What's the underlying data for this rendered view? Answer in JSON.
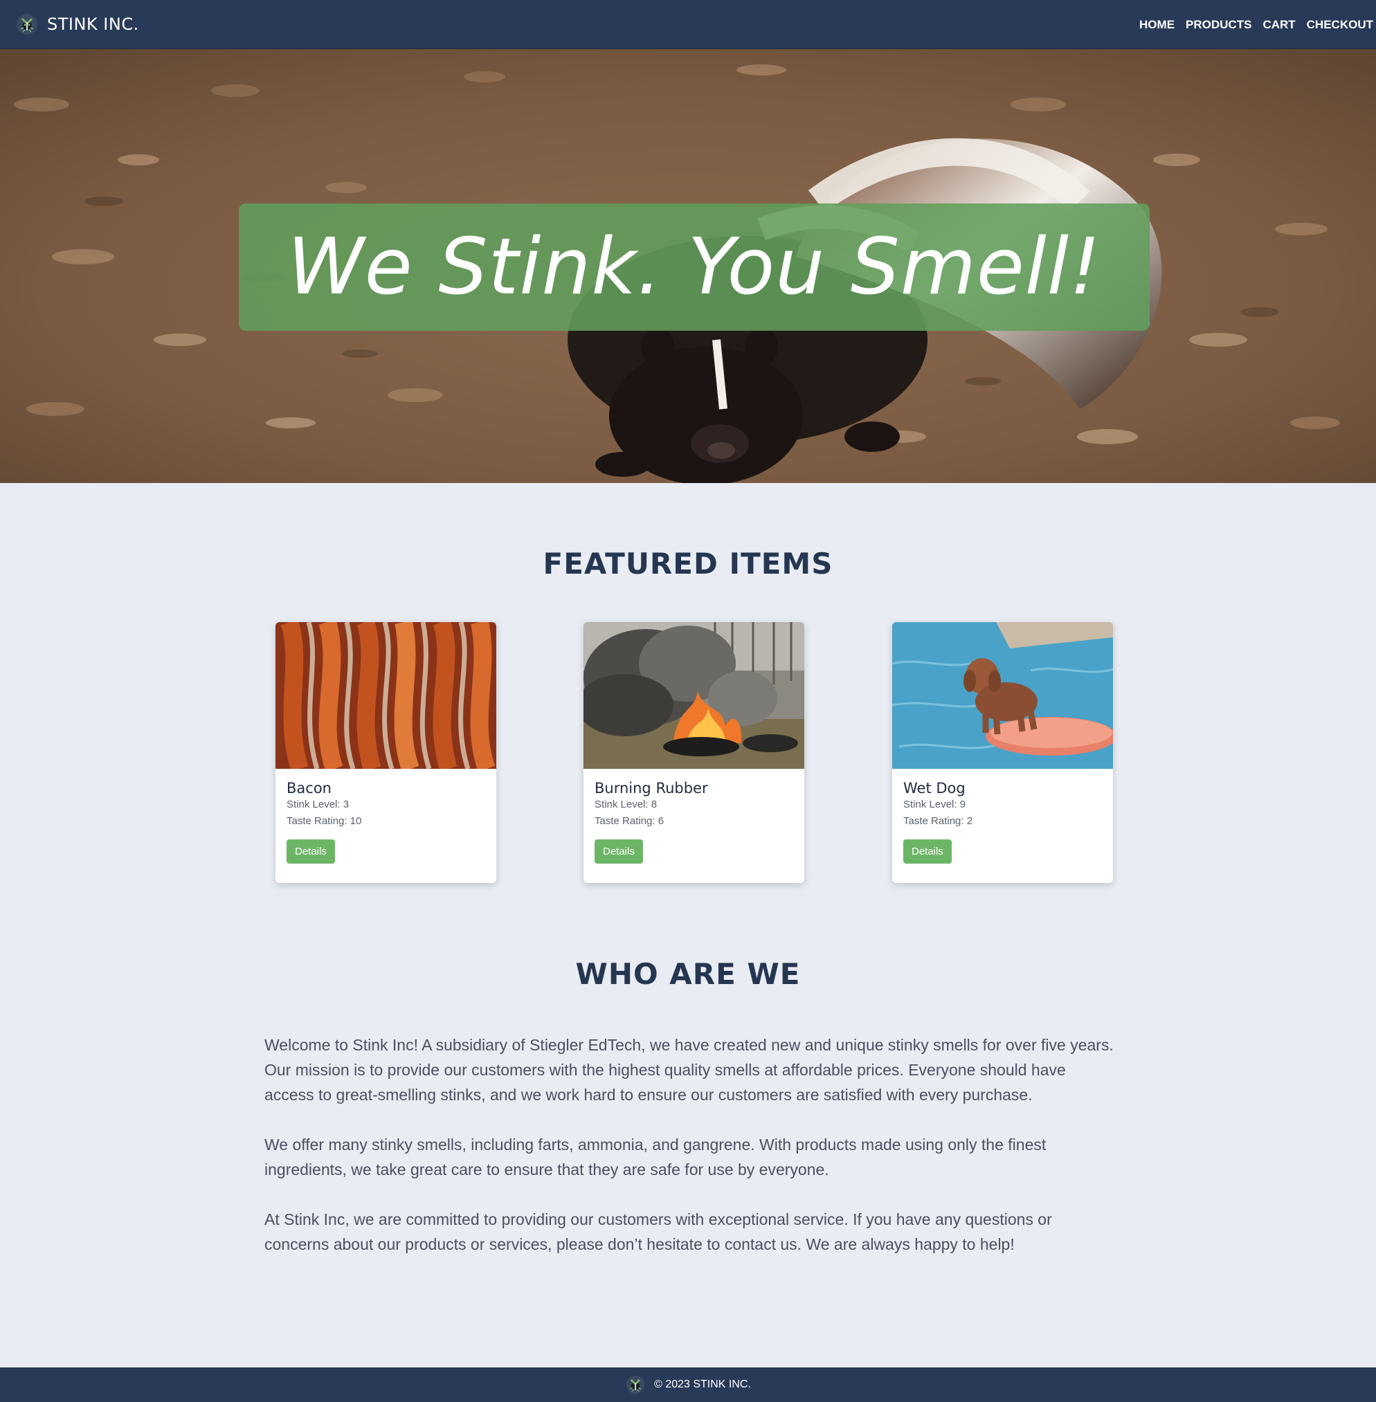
{
  "brand": {
    "name": "STINK INC.",
    "logo_icon": "skunk-logo-icon"
  },
  "nav": {
    "links": [
      "HOME",
      "PRODUCTS",
      "CART",
      "CHECKOUT"
    ]
  },
  "hero": {
    "headline": "We Stink. You Smell!",
    "background_image": "skunk-photo",
    "banner_color": "#629e5c"
  },
  "featured": {
    "title": "FEATURED ITEMS",
    "items": [
      {
        "name": "Bacon",
        "stink_level": "Stink Level: 3",
        "taste_rating": "Taste Rating: 10",
        "button": "Details",
        "image": "bacon-photo"
      },
      {
        "name": "Burning Rubber",
        "stink_level": "Stink Level: 8",
        "taste_rating": "Taste Rating: 6",
        "button": "Details",
        "image": "burning-tire-photo"
      },
      {
        "name": "Wet Dog",
        "stink_level": "Stink Level: 9",
        "taste_rating": "Taste Rating: 2",
        "button": "Details",
        "image": "wet-dog-photo"
      }
    ]
  },
  "about": {
    "title": "WHO ARE WE",
    "paragraphs": [
      "Welcome to Stink Inc! A subsidiary of Stiegler EdTech, we have created new and unique stinky smells for over five years. Our mission is to provide our customers with the highest quality smells at affordable prices. Everyone should have access to great-smelling stinks, and we work hard to ensure our customers are satisfied with every purchase.",
      "We offer many stinky smells, including farts, ammonia, and gangrene. With products made using only the finest ingredients, we take great care to ensure that they are safe for use by everyone.",
      "At Stink Inc, we are committed to providing our customers with exceptional service. If you have any questions or concerns about our products or services, please don’t hesitate to contact us. We are always happy to help!"
    ]
  },
  "footer": {
    "text": "© 2023 STINK INC."
  },
  "colors": {
    "navbar": "#283a57",
    "page_bg": "#e9ecf3",
    "accent_green": "#6db566"
  }
}
